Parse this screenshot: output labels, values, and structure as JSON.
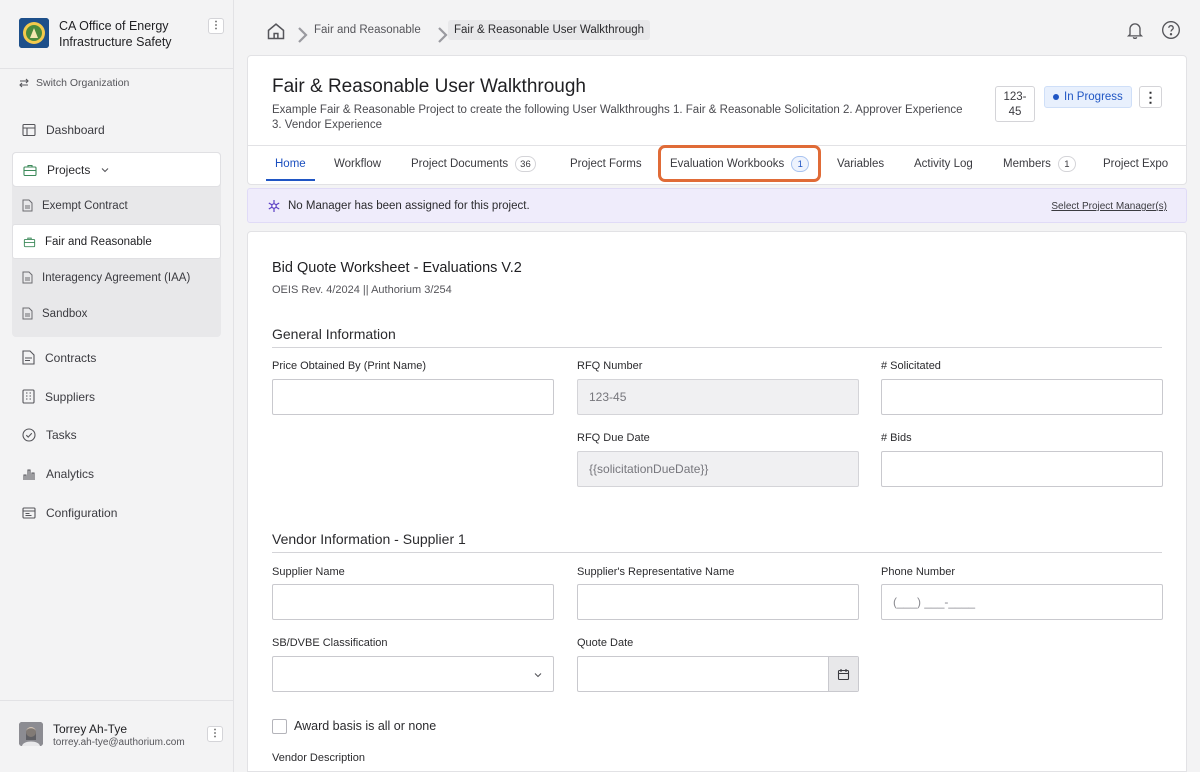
{
  "sidebar": {
    "org_name": "CA Office of Energy Infrastructure Safety",
    "switch_org": "Switch Organization",
    "nav": {
      "dashboard": "Dashboard",
      "projects": "Projects",
      "contracts": "Contracts",
      "suppliers": "Suppliers",
      "tasks": "Tasks",
      "analytics": "Analytics",
      "configuration": "Configuration"
    },
    "project_items": [
      "Exempt Contract",
      "Fair and Reasonable",
      "Interagency Agreement (IAA)",
      "Sandbox"
    ],
    "user": {
      "name": "Torrey Ah-Tye",
      "email": "torrey.ah-tye@authorium.com"
    }
  },
  "breadcrumb": {
    "parent": "Fair and Reasonable",
    "current": "Fair & Reasonable User Walkthrough"
  },
  "project": {
    "title": "Fair & Reasonable User Walkthrough",
    "description": "Example Fair & Reasonable Project to create the following User Walkthroughs 1. Fair & Reasonable Solicitation 2. Approver Experience 3. Vendor Experience",
    "rfq_line1": "123-",
    "rfq_line2": "45",
    "status": "In Progress"
  },
  "tabs": {
    "home": "Home",
    "workflow": "Workflow",
    "documents": "Project Documents",
    "documents_count": "36",
    "forms": "Project Forms",
    "workbooks": "Evaluation Workbooks",
    "workbooks_count": "1",
    "variables": "Variables",
    "activity": "Activity Log",
    "members": "Members",
    "members_count": "1",
    "export": "Project Expo"
  },
  "alert": {
    "text": "No Manager has been assigned for this project.",
    "link": "Select Project Manager(s)"
  },
  "form": {
    "title": "Bid Quote Worksheet - Evaluations V.2",
    "subtitle": "OEIS Rev. 4/2024 || Authorium 3/254",
    "general_section": "General Information",
    "price_obtained_label": "Price Obtained By (Print Name)",
    "rfq_number_label": "RFQ Number",
    "rfq_number_value": "123-45",
    "solicited_label": "# Solicitated",
    "rfq_due_label": "RFQ Due Date",
    "rfq_due_value": "{{solicitationDueDate}}",
    "bids_label": "# Bids",
    "vendor_section": "Vendor Information - Supplier 1",
    "supplier_name_label": "Supplier Name",
    "rep_name_label": "Supplier's Representative Name",
    "phone_label": "Phone Number",
    "phone_placeholder": "(___) ___-____",
    "sb_label": "SB/DVBE Classification",
    "quote_date_label": "Quote Date",
    "award_label": "Award basis is all or none",
    "vendor_desc_label": "Vendor Description"
  },
  "colors": {
    "accent": "#2056c4",
    "highlight": "#e06b37",
    "alert_bg": "#efecfb"
  }
}
